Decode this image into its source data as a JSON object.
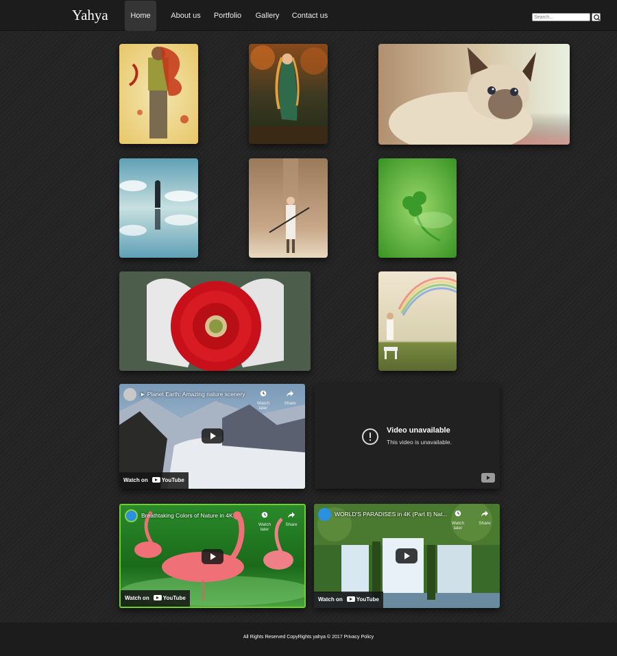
{
  "brand": "Yahya",
  "nav": {
    "items": [
      {
        "label": "Home"
      },
      {
        "label": "About us"
      },
      {
        "label": "Portfolio"
      },
      {
        "label": "Gallery"
      },
      {
        "label": "Contact us"
      }
    ],
    "active_index": 0
  },
  "search": {
    "placeholder": "Search..."
  },
  "gallery": {
    "photos": [
      {
        "subject": "painted figure with red splatter"
      },
      {
        "subject": "fantasy warrior woman in autumn forest"
      },
      {
        "subject": "siamese kitten"
      },
      {
        "subject": "person standing on reflective salt flat"
      },
      {
        "subject": "girl with staff against wall"
      },
      {
        "subject": "green clover leaf"
      },
      {
        "subject": "hands holding red gerbera flower"
      },
      {
        "subject": "child painting rainbow in field"
      }
    ]
  },
  "videos": [
    {
      "title": "► Planet Earth: Amazing nature scenery",
      "watch_later": "Watch later",
      "share": "Share",
      "watch_on": "Watch on",
      "logo": "YouTube"
    },
    {
      "unavailable_title": "Video unavailable",
      "unavailable_message": "This video is unavailable."
    },
    {
      "title": "Breathtaking Colors of Nature in 4K",
      "watch_later": "Watch later",
      "share": "Share",
      "watch_on": "Watch on",
      "logo": "YouTube"
    },
    {
      "title": "WORLD'S PARADISES in 4K (Part II) Nat...",
      "watch_later": "Watch later",
      "share": "Share",
      "watch_on": "Watch on",
      "logo": "YouTube"
    }
  ],
  "footer": {
    "text": "All Rights Reserved CopyRights yahya © 2017 Privacy Policy"
  },
  "colors": {
    "background": "#232323",
    "navbar": "#1c1c1c",
    "active_nav": "#353535",
    "highlight_border": "#6fd12a"
  }
}
